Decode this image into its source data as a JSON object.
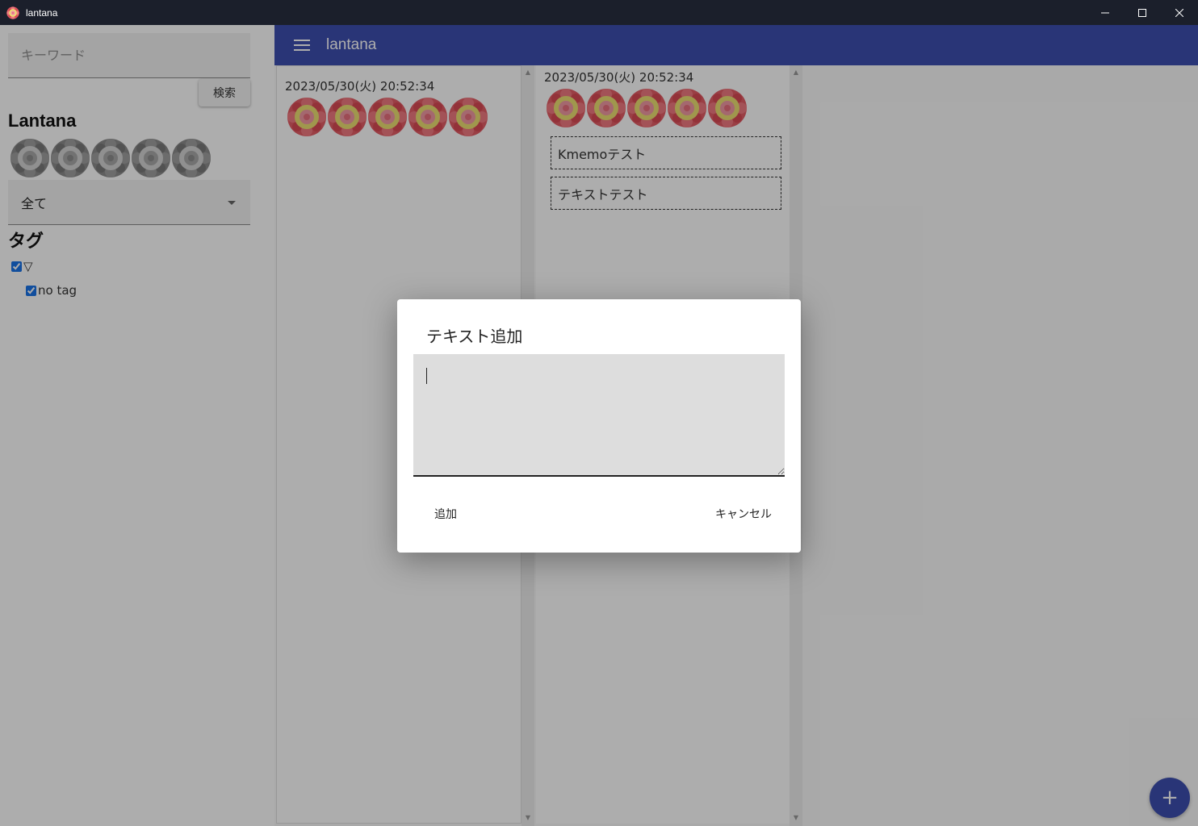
{
  "window": {
    "title": "lantana"
  },
  "sidebar": {
    "search_placeholder": "キーワード",
    "search_value": "",
    "search_button": "検索",
    "brand_title": "Lantana",
    "filter_select": "全て",
    "tag_heading": "タグ",
    "tag_root_label": "▽",
    "tags": [
      {
        "label": "no tag",
        "checked": true
      }
    ]
  },
  "appbar": {
    "title": "lantana"
  },
  "columns": [
    {
      "timestamp": "2023/05/30(火) 20:52:34",
      "memos": []
    },
    {
      "timestamp": "2023/05/30(火) 20:52:34",
      "memos": [
        "Kmemoテスト",
        "テキストテスト"
      ]
    }
  ],
  "dialog": {
    "title": "テキスト追加",
    "text_value": "",
    "add_button": "追加",
    "cancel_button": "キャンセル"
  },
  "fab": {
    "label": "+"
  },
  "colors": {
    "primary": "#3d4fb0",
    "titlebar": "#1b1f2b",
    "flower_petal": "#e05a63",
    "flower_center": "#e8d96a"
  }
}
